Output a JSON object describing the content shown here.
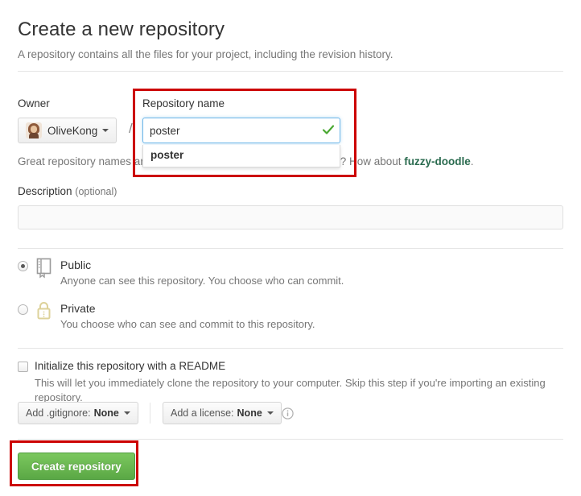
{
  "header": {
    "title": "Create a new repository",
    "subtitle": "A repository contains all the files for your project, including the revision history."
  },
  "owner": {
    "label": "Owner",
    "name": "OliveKong",
    "avatar_icon": "user-avatar-icon",
    "caret_icon": "chevron-down-icon",
    "separator": "/"
  },
  "repository_name": {
    "label": "Repository name",
    "value": "poster",
    "placeholder": "",
    "valid_icon": "check-icon",
    "autocomplete": {
      "items": [
        "poster"
      ]
    }
  },
  "name_hint": {
    "prefix": "Great repository names are short and memorable. Need inspiration? How about ",
    "link": "fuzzy-doodle",
    "suffix": "."
  },
  "description": {
    "label": "Description",
    "optional": "(optional)",
    "value": "",
    "placeholder": ""
  },
  "visibility": {
    "public": {
      "title": "Public",
      "description": "Anyone can see this repository. You choose who can commit.",
      "selected": true,
      "icon": "repo-book-icon"
    },
    "private": {
      "title": "Private",
      "description": "You choose who can see and commit to this repository.",
      "selected": false,
      "icon": "lock-icon"
    }
  },
  "readme": {
    "title": "Initialize this repository with a README",
    "description": "This will let you immediately clone the repository to your computer. Skip this step if you're importing an existing repository.",
    "checked": false
  },
  "gitignore": {
    "label": "Add .gitignore:",
    "value": "None",
    "caret_icon": "chevron-down-icon"
  },
  "license": {
    "label": "Add a license:",
    "value": "None",
    "caret_icon": "chevron-down-icon",
    "info_icon": "info-circle-icon"
  },
  "submit": {
    "label": "Create repository"
  },
  "colors": {
    "accent_green": "#6cc644",
    "link_green": "#2a6b4f",
    "focus_blue": "#6cb6e8",
    "annotation_red": "#cc0000",
    "muted_text": "#767676",
    "lock_yellow": "#e8dca0"
  }
}
